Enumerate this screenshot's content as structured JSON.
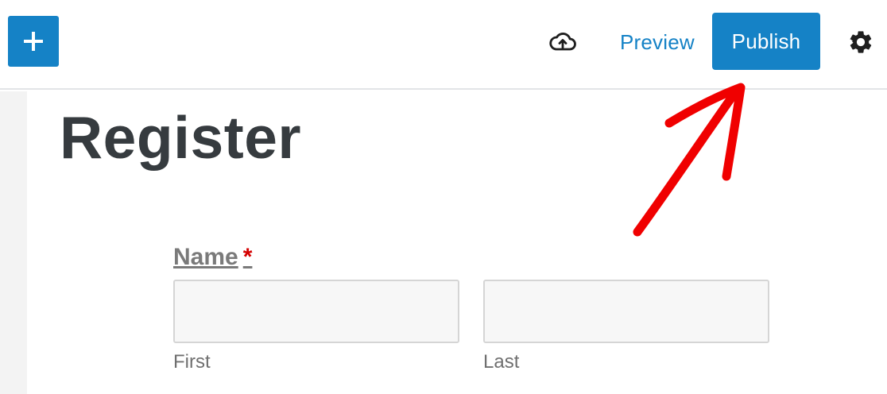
{
  "toolbar": {
    "add_block_icon": "plus-icon",
    "save_draft_icon": "cloud-upload-icon",
    "preview_label": "Preview",
    "publish_label": "Publish",
    "settings_icon": "gear-icon",
    "accent_color": "#1582c6"
  },
  "page": {
    "title": "Register"
  },
  "form": {
    "name_field": {
      "label": "Name",
      "required_marker": "*",
      "first": {
        "value": "",
        "sublabel": "First"
      },
      "last": {
        "value": "",
        "sublabel": "Last"
      }
    }
  },
  "annotation": {
    "type": "arrow",
    "color": "#f00000",
    "points_to": "publish-button"
  }
}
